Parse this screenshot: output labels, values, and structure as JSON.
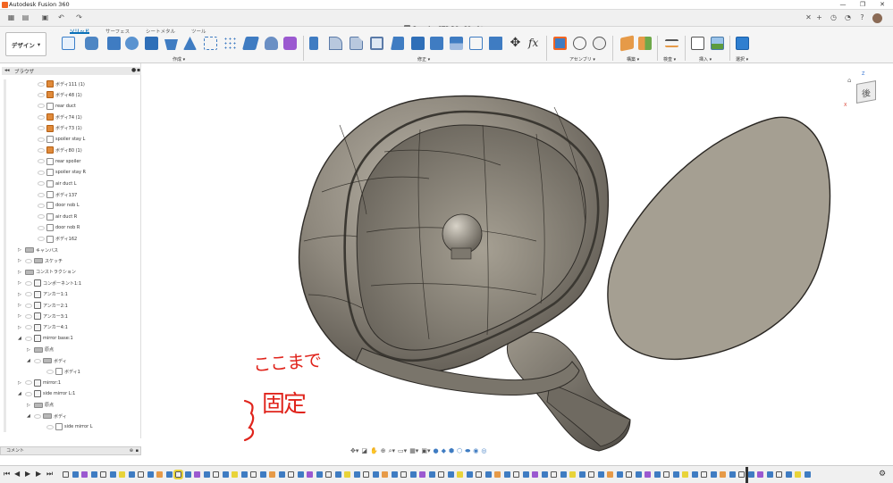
{
  "titlebar": {
    "app_title": "Autodesk Fusion 360"
  },
  "doc": {
    "tab_title": "Porsche   GT3 RS v32 v1*"
  },
  "ribbon": {
    "workspace_label": "デザイン",
    "tabs": [
      "ソリッド",
      "サーフェス",
      "シートメタル",
      "ツール"
    ],
    "active_tab": "ソリッド",
    "groups": [
      {
        "label": "作成 ▾"
      },
      {
        "label": "修正 ▾"
      },
      {
        "label": "アセンブリ ▾"
      },
      {
        "label": "構築 ▾"
      },
      {
        "label": "検査 ▾"
      },
      {
        "label": "挿入 ▾"
      },
      {
        "label": "選択 ▾"
      }
    ]
  },
  "browser": {
    "title": "ブラウザ",
    "items": [
      {
        "label": "ボディ111 (1)",
        "icon": "body-orange"
      },
      {
        "label": "ボディ48 (1)",
        "icon": "body-orange"
      },
      {
        "label": "rear duct",
        "icon": "body-white"
      },
      {
        "label": "ボディ74 (1)",
        "icon": "body-orange"
      },
      {
        "label": "ボディ73 (1)",
        "icon": "body-orange"
      },
      {
        "label": "spoiler stay L",
        "icon": "body-white"
      },
      {
        "label": "ボディ80 (1)",
        "icon": "body-orange"
      },
      {
        "label": "rear spoiler",
        "icon": "body-white"
      },
      {
        "label": "spoiler stay R",
        "icon": "body-white"
      },
      {
        "label": "air duct L",
        "icon": "body-white"
      },
      {
        "label": "ボディ137",
        "icon": "body-white"
      },
      {
        "label": "door nob L",
        "icon": "body-white"
      },
      {
        "label": "air duct R",
        "icon": "body-white"
      },
      {
        "label": "door nob R",
        "icon": "body-white"
      },
      {
        "label": "ボディ162",
        "icon": "body-white"
      },
      {
        "label": "キャンバス",
        "icon": "folder"
      },
      {
        "label": "スケッチ",
        "icon": "folder"
      },
      {
        "label": "コンストラクション",
        "icon": "folder"
      },
      {
        "label": "コンポーネント1:1",
        "icon": "component"
      },
      {
        "label": "アンカー1:1",
        "icon": "component"
      },
      {
        "label": "アンカー2:1",
        "icon": "component"
      },
      {
        "label": "アンカー3:1",
        "icon": "component"
      },
      {
        "label": "アンカー4:1",
        "icon": "component"
      },
      {
        "label": "mirror base:1",
        "icon": "component"
      },
      {
        "label": "原点",
        "icon": "folder"
      },
      {
        "label": "ボディ",
        "icon": "folder"
      },
      {
        "label": "ボディ1",
        "icon": "body-white"
      },
      {
        "label": "mirror:1",
        "icon": "component"
      },
      {
        "label": "side mirror L:1",
        "icon": "component"
      },
      {
        "label": "原点",
        "icon": "folder"
      },
      {
        "label": "ボディ",
        "icon": "folder"
      },
      {
        "label": "side mirror L",
        "icon": "body-white"
      }
    ]
  },
  "comment": {
    "label": "コメント"
  },
  "annotation": {
    "line1": "ここまで",
    "line2": "固定"
  },
  "viewcube": {
    "face_label": "後",
    "axis_x": "X",
    "axis_z": "Z"
  },
  "colors": {
    "accent": "#0a70b8",
    "annotation": "#e0241c",
    "body_orange": "#e08a3a"
  }
}
